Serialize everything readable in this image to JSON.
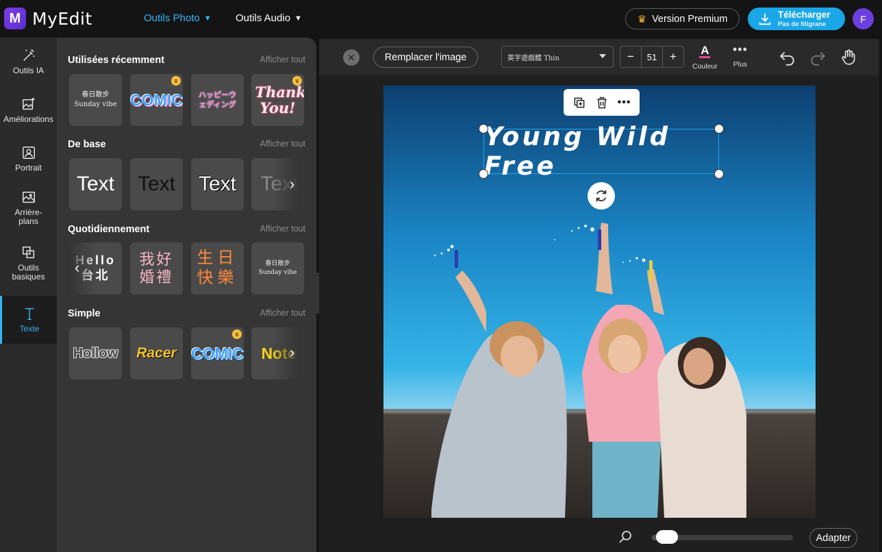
{
  "app": {
    "name": "MyEdit",
    "logo_letter": "M"
  },
  "nav": {
    "photo": "Outils Photo",
    "audio": "Outils Audio"
  },
  "header": {
    "premium": "Version Premium",
    "download_main": "Télécharger",
    "download_sub": "Pas de filigrane",
    "avatar": "F"
  },
  "leftnav": [
    {
      "label": "Outils IA",
      "icon": "magic-wand-icon"
    },
    {
      "label": "Améliorations",
      "icon": "image-sparkle-icon"
    },
    {
      "label": "Portrait",
      "icon": "portrait-icon"
    },
    {
      "label": "Arrière-plans",
      "icon": "background-icon"
    },
    {
      "label": "Outils basiques",
      "icon": "crop-icon"
    },
    {
      "label": "Texte",
      "icon": "text-icon"
    }
  ],
  "panel": {
    "more_label": "Afficher tout",
    "sections": [
      {
        "title": "Utilisées récemment",
        "tiles": [
          "春日散步 Sunday vibe",
          "COMIC",
          "ハッピーウェディング",
          "Thank You!"
        ]
      },
      {
        "title": "De base",
        "tiles": [
          "Text",
          "Text",
          "Text",
          "Text"
        ]
      },
      {
        "title": "Quotidiennement",
        "tiles": [
          "Hello 台北",
          "我好婚禮",
          "生日快樂",
          "春日散步 Sunday vibe"
        ]
      },
      {
        "title": "Simple",
        "tiles": [
          "Hollow",
          "Racer",
          "COMIC",
          "Note"
        ]
      }
    ]
  },
  "toolbar": {
    "replace": "Remplacer l'image",
    "font": "英字遊戲體 Thin",
    "size": "51",
    "minus": "−",
    "plus": "+",
    "color_label": "Couleur",
    "color_glyph": "A",
    "more_label": "Plus"
  },
  "canvas": {
    "text": "Young Wild Free"
  },
  "footer": {
    "fit": "Adapter",
    "zoom_level": 0.06
  },
  "colors": {
    "accent": "#36b4f5",
    "download": "#1aa7e8",
    "avatar": "#6c3fe0"
  }
}
